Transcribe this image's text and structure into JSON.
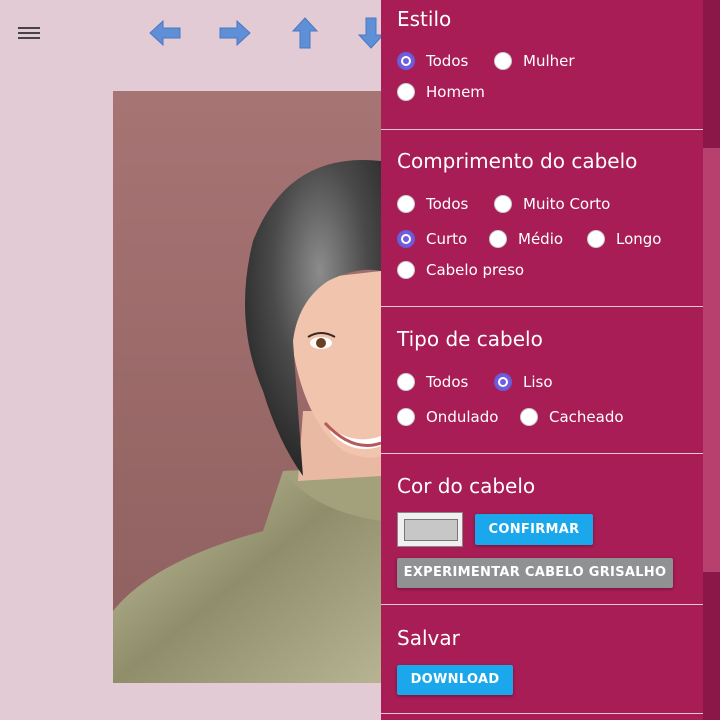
{
  "toolbar": {
    "icons": [
      "menu-icon",
      "arrow-left-icon",
      "arrow-right-icon",
      "arrow-up-icon",
      "arrow-down-icon"
    ],
    "arrow_color": "#5f8fd6"
  },
  "panel": {
    "background": "#a81d55",
    "style": {
      "title": "Estilo",
      "options": [
        {
          "label": "Todos",
          "checked": true
        },
        {
          "label": "Mulher",
          "checked": false
        },
        {
          "label": "Homem",
          "checked": false
        }
      ]
    },
    "length": {
      "title": "Comprimento do cabelo",
      "options": [
        {
          "label": "Todos",
          "checked": false
        },
        {
          "label": "Muito Corto",
          "checked": false
        },
        {
          "label": "Curto",
          "checked": true
        },
        {
          "label": "Médio",
          "checked": false
        },
        {
          "label": "Longo",
          "checked": false
        },
        {
          "label": "Cabelo preso",
          "checked": false
        }
      ]
    },
    "type": {
      "title": "Tipo de cabelo",
      "options": [
        {
          "label": "Todos",
          "checked": false
        },
        {
          "label": "Liso",
          "checked": true
        },
        {
          "label": "Ondulado",
          "checked": false
        },
        {
          "label": "Cacheado",
          "checked": false
        }
      ]
    },
    "color": {
      "title": "Cor do cabelo",
      "swatch_color": "#c7c7c7",
      "confirm_label": "CONFIRMAR",
      "gray_label": "EXPERIMENTAR CABELO GRISALHO"
    },
    "save": {
      "title": "Salvar",
      "download_label": "DOWNLOAD"
    }
  }
}
